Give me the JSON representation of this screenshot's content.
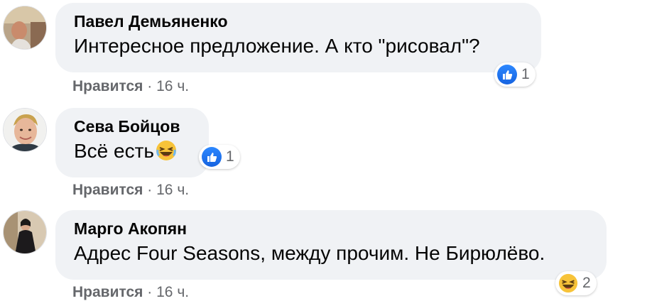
{
  "comments": [
    {
      "author": "Павел Демьяненко",
      "text": "Интересное предложение. А кто \"рисовал\"?",
      "reaction": {
        "icon": "like-icon",
        "count": "1"
      },
      "like_label": "Нравится",
      "separator": "·",
      "time": "16 ч."
    },
    {
      "author": "Сева Бойцов",
      "text": "Всё есть",
      "inline_emoji": "haha-emoji-icon",
      "reaction": {
        "icon": "like-icon",
        "count": "1"
      },
      "like_label": "Нравится",
      "separator": "·",
      "time": "16 ч."
    },
    {
      "author": "Марго Акопян",
      "text": "Адрес Four Seasons, между прочим. Не Бирюлёво.",
      "reaction": {
        "icon": "haha-icon",
        "count": "2"
      },
      "like_label": "Нравится",
      "separator": "·",
      "time": "16 ч."
    }
  ],
  "colors": {
    "bubble": "#f0f2f5",
    "like_blue": "#1877f2",
    "meta_gray": "#65676b",
    "haha_yellow": "#f7c339"
  }
}
